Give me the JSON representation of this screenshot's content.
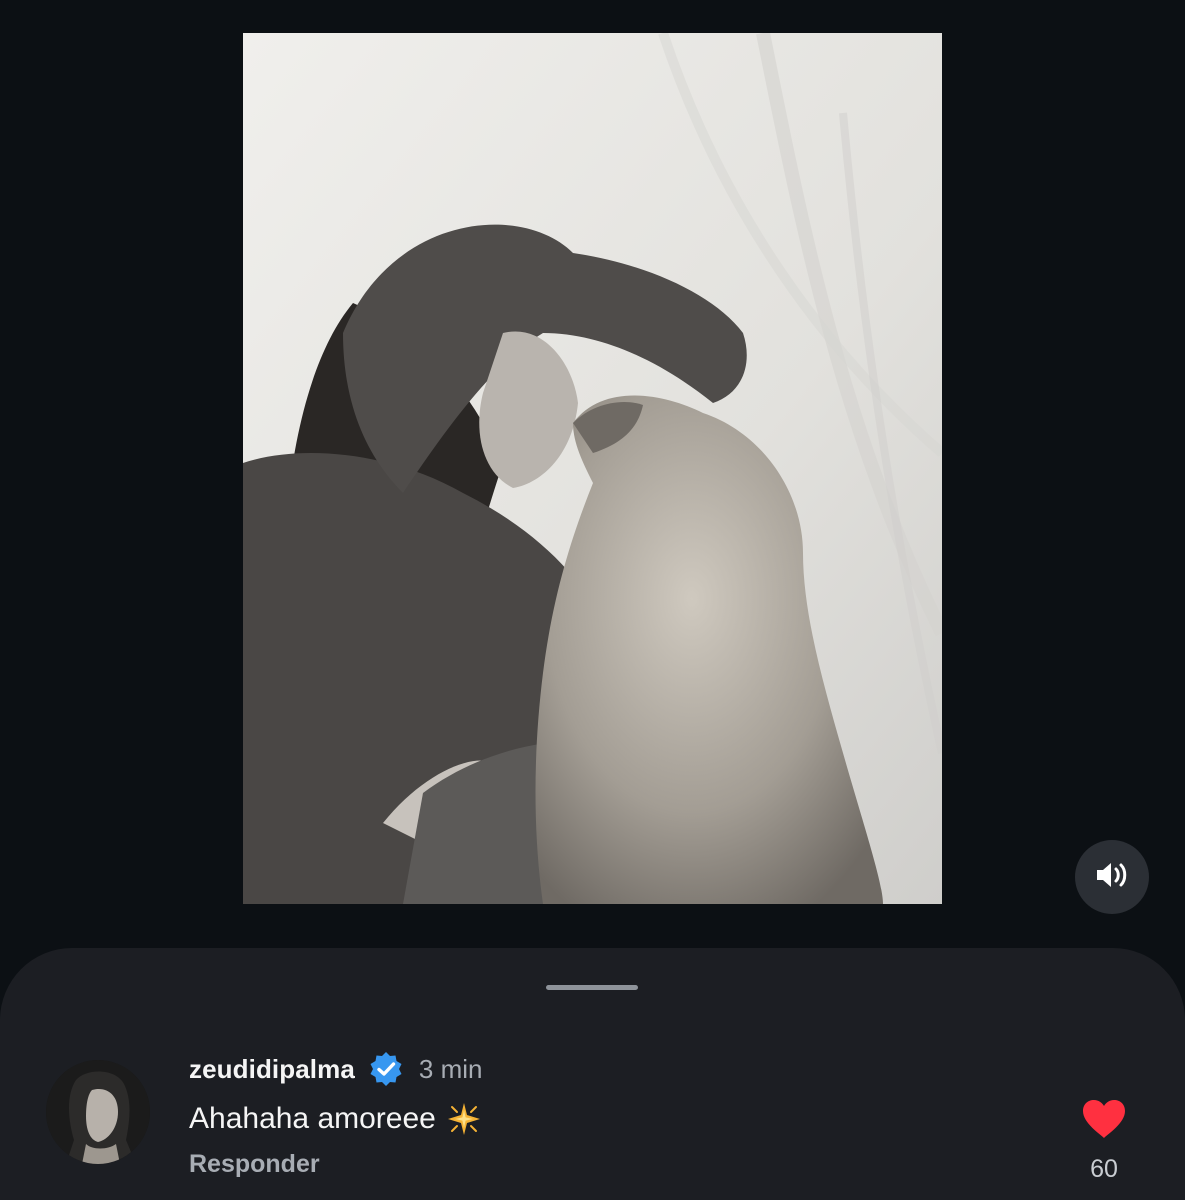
{
  "post": {
    "image_icon": "photo-woman-kissing-dog",
    "sound_icon": "speaker-on-icon"
  },
  "comments_sheet": {
    "comment": {
      "avatar_icon": "profile-photo",
      "username": "zeudidipalma",
      "verified_icon": "verified-badge-icon",
      "time": "3 min",
      "text": "Ahahaha amoreee",
      "emoji_icon": "sparkle-star-emoji",
      "reply_label": "Responder",
      "like_icon": "heart-filled-icon",
      "like_count": "60"
    }
  },
  "colors": {
    "background": "#0c1014",
    "sheet": "#1c1e23",
    "verified": "#3797f0",
    "like": "#ff3040"
  }
}
